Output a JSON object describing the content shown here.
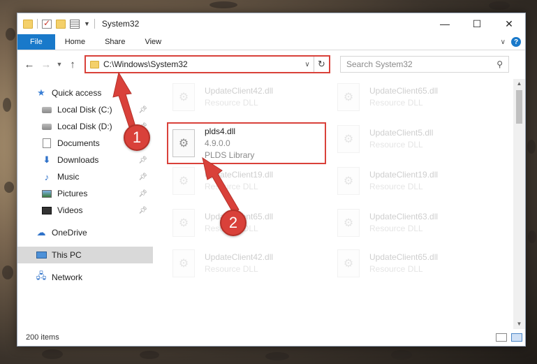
{
  "window": {
    "title": "System32"
  },
  "ribbon": {
    "tabs": [
      "File",
      "Home",
      "Share",
      "View"
    ],
    "help": "?"
  },
  "address": {
    "path": "C:\\Windows\\System32"
  },
  "search": {
    "placeholder": "Search System32"
  },
  "sidebar": {
    "items": [
      {
        "label": "Quick access",
        "icon": "star-icon"
      },
      {
        "label": "Local Disk (C:)",
        "icon": "disk-icon",
        "pinned": true
      },
      {
        "label": "Local Disk (D:)",
        "icon": "disk-icon",
        "pinned": true
      },
      {
        "label": "Documents",
        "icon": "documents-icon",
        "pinned": true
      },
      {
        "label": "Downloads",
        "icon": "download-icon",
        "pinned": true
      },
      {
        "label": "Music",
        "icon": "music-icon",
        "pinned": true
      },
      {
        "label": "Pictures",
        "icon": "pictures-icon",
        "pinned": true
      },
      {
        "label": "Videos",
        "icon": "videos-icon",
        "pinned": true
      },
      {
        "label": "OneDrive",
        "icon": "cloud-icon"
      },
      {
        "label": "This PC",
        "icon": "computer-icon",
        "selected": true
      },
      {
        "label": "Network",
        "icon": "network-icon"
      }
    ]
  },
  "files": {
    "highlighted": {
      "name": "plds4.dll",
      "version": "4.9.0.0",
      "description": "PLDS Library"
    },
    "col1": [
      {
        "name": "UpdateClient42.dll",
        "type": "Resource DLL"
      },
      {
        "name": "UpdateClient19.dll",
        "type": "Resource DLL"
      },
      {
        "name": "UpdateClient65.dll",
        "type": "Resource DLL"
      },
      {
        "name": "UpdateClient42.dll",
        "type": "Resource DLL"
      }
    ],
    "col2": [
      {
        "name": "UpdateClient65.dll",
        "type": "Resource DLL"
      },
      {
        "name": "UpdateClient5.dll",
        "type": "Resource DLL"
      },
      {
        "name": "UpdateClient19.dll",
        "type": "Resource DLL"
      },
      {
        "name": "UpdateClient63.dll",
        "type": "Resource DLL"
      },
      {
        "name": "UpdateClient65.dll",
        "type": "Resource DLL"
      }
    ]
  },
  "status": {
    "count": "200 items"
  },
  "annotations": {
    "step1": "1",
    "step2": "2",
    "color": "#d9413a"
  }
}
